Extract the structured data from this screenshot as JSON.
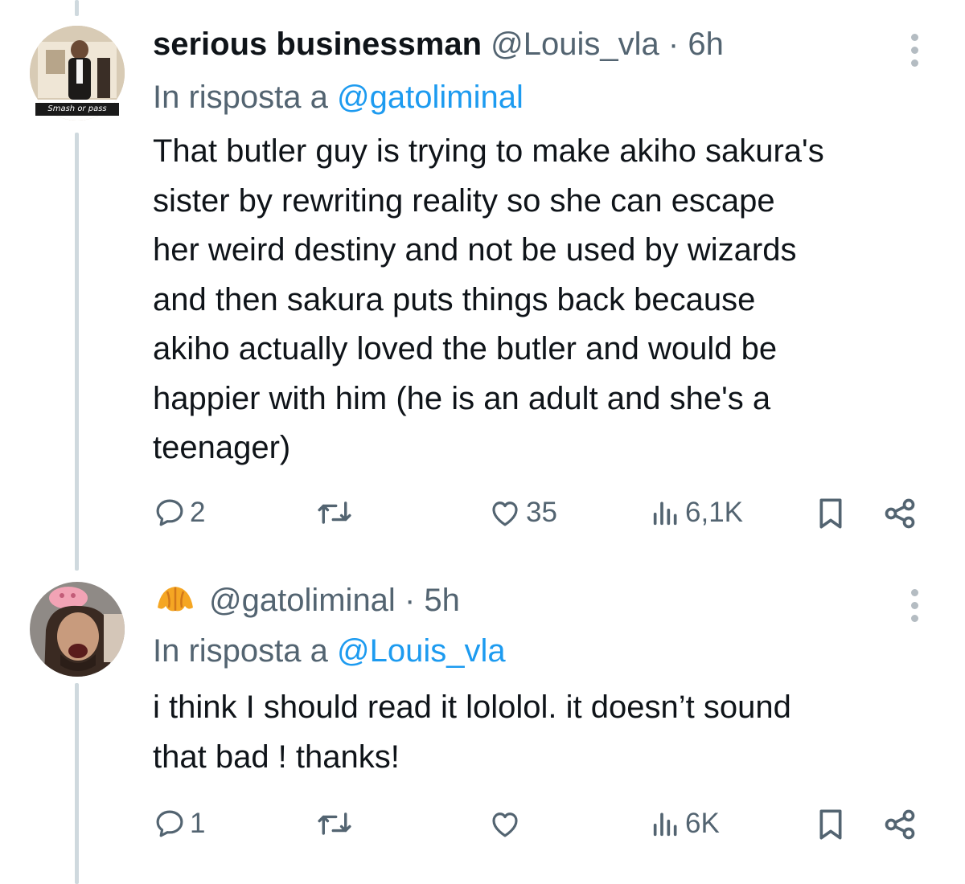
{
  "tweets": [
    {
      "display_name": "serious businessman",
      "handle": "@Louis_vla",
      "time": "· 6h",
      "reply_prefix": "In risposta a",
      "reply_to": "@gatoliminal",
      "avatar_caption": "Smash or pass",
      "text_lines": [
        "That butler guy is trying to make akiho sakura's",
        "sister by rewriting reality so she can escape",
        "her weird destiny and not be used by wizards",
        "and then sakura puts things back because",
        "akiho actually loved the butler and would be",
        "happier with him (he is an adult and she's a",
        "teenager)"
      ],
      "stats": {
        "replies": "2",
        "retweets": "",
        "likes": "35",
        "views": "6,1K"
      }
    },
    {
      "display_name": "",
      "emoji_icon": "croissant-icon",
      "handle": "@gatoliminal",
      "time": "· 5h",
      "reply_prefix": "In risposta a",
      "reply_to": "@Louis_vla",
      "text_lines": [
        "i think I should read it lololol. it doesn’t sound",
        "that bad ! thanks!"
      ],
      "stats": {
        "replies": "1",
        "retweets": "",
        "likes": "",
        "views": "6K"
      }
    }
  ],
  "colors": {
    "link": "#1d9bf0",
    "muted": "#536471",
    "text": "#0f1419",
    "thread_line": "#cfd9de"
  }
}
